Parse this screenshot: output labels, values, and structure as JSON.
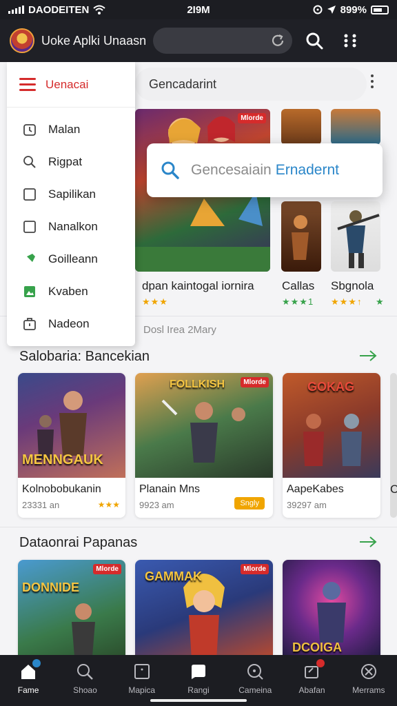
{
  "status_bar": {
    "carrier": "DAODEITEN",
    "time": "2I9M",
    "battery": "899%"
  },
  "header": {
    "app_title": "Uoke Aplki Unaasn",
    "avatar_icon": "avatar",
    "search_icon": "search-icon",
    "menu_icon": "grid-menu-icon"
  },
  "search": {
    "pill_text": "Gencadarint",
    "popup_text": "Gencesaiain",
    "popup_accent": "Ernadernt"
  },
  "drawer": {
    "title": "Uenacai",
    "items": [
      {
        "label": "Malan",
        "icon": "clock-icon"
      },
      {
        "label": "Rigpat",
        "icon": "search-icon"
      },
      {
        "label": "Sapilikan",
        "icon": "square-icon"
      },
      {
        "label": "Nanalkon",
        "icon": "square-icon"
      },
      {
        "label": "Goilleann",
        "icon": "pin-icon"
      },
      {
        "label": "Kvaben",
        "icon": "photo-icon"
      },
      {
        "label": "Nadeon",
        "icon": "briefcase-icon"
      }
    ]
  },
  "featured": {
    "items": [
      {
        "title": "dpan kaintogal iornira",
        "stars": "★★★",
        "badge": "Mlorde"
      },
      {
        "title": "Callas",
        "stars": "★★★1"
      },
      {
        "title": "Sbgnola",
        "stars": "★★★↑"
      }
    ],
    "extra_stars": "★",
    "divider_text": "Dosl Irea 2Mary"
  },
  "sections": [
    {
      "title": "Salobaria: Bancekian",
      "cards": [
        {
          "name": "Kolnobobukanin",
          "meta": "23331 an",
          "rating": "★★★",
          "overlay": "MENNGAUK"
        },
        {
          "name": "Planain Mns",
          "meta": "9923 am",
          "tag": "Sngly",
          "overlay": "FOLLKISH"
        },
        {
          "name": "AapeKabes",
          "meta": "39297 am",
          "overlay": "GOKAG"
        }
      ],
      "partial_letter": "C"
    },
    {
      "title": "Dataonrai Papanas",
      "cards": [
        {
          "name": "",
          "overlay": "DONNIDE",
          "badge": "Mlorde"
        },
        {
          "name": "",
          "overlay": "GAMMAK",
          "badge": "Mlorde"
        },
        {
          "name": "",
          "overlay": "DCOIGA"
        }
      ]
    }
  ],
  "bottom_nav": [
    {
      "label": "Fame",
      "icon": "home-icon",
      "active": true
    },
    {
      "label": "Shoao",
      "icon": "search-icon"
    },
    {
      "label": "Mapica",
      "icon": "square-icon"
    },
    {
      "label": "Rangi",
      "icon": "chat-icon"
    },
    {
      "label": "Cameina",
      "icon": "compass-icon"
    },
    {
      "label": "Abafan",
      "icon": "notification-icon"
    },
    {
      "label": "Merrams",
      "icon": "profile-icon"
    }
  ],
  "colors": {
    "accent_red": "#d52b2b",
    "accent_blue": "#2a86c9",
    "accent_green": "#37a24b",
    "star": "#f0a500"
  }
}
